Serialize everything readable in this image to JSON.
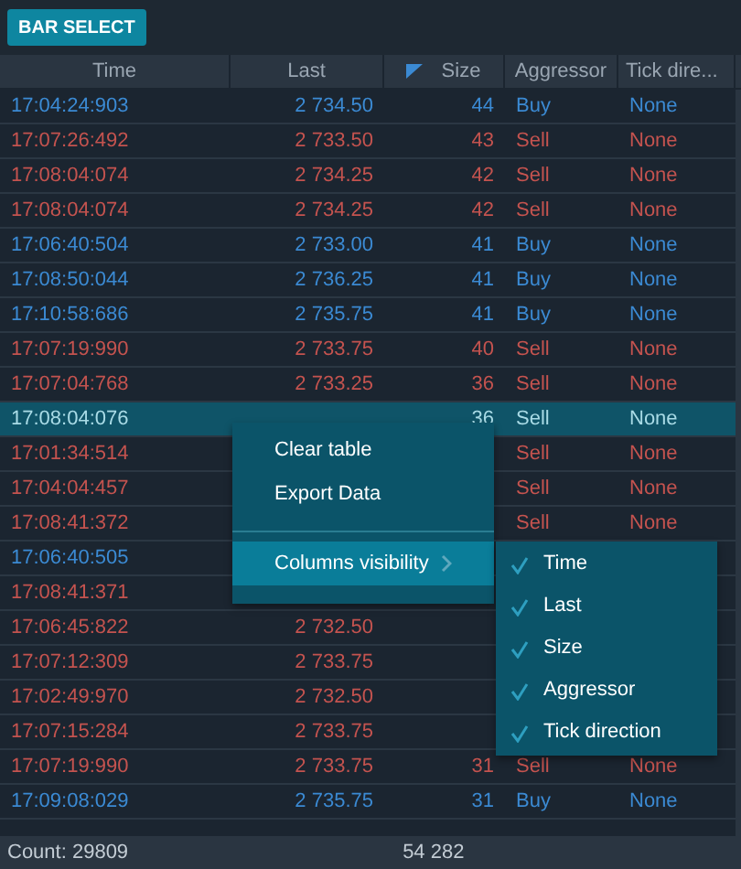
{
  "toolbar": {
    "button": "BAR SELECT"
  },
  "table": {
    "columns": [
      {
        "label": "Time",
        "sorted": false
      },
      {
        "label": "Last",
        "sorted": false
      },
      {
        "label": "Size",
        "sorted": true
      },
      {
        "label": "Aggressor",
        "sorted": false
      },
      {
        "label": "Tick dire...",
        "sorted": false
      }
    ],
    "rows": [
      {
        "time": "17:04:24:903",
        "last": "2 734.50",
        "size": "44",
        "aggressor": "Buy",
        "tick": "None",
        "color": "#3b8ad3",
        "selected": false
      },
      {
        "time": "17:07:26:492",
        "last": "2 733.50",
        "size": "43",
        "aggressor": "Sell",
        "tick": "None",
        "color": "#c4534f",
        "selected": false
      },
      {
        "time": "17:08:04:074",
        "last": "2 734.25",
        "size": "42",
        "aggressor": "Sell",
        "tick": "None",
        "color": "#c4534f",
        "selected": false
      },
      {
        "time": "17:08:04:074",
        "last": "2 734.25",
        "size": "42",
        "aggressor": "Sell",
        "tick": "None",
        "color": "#c4534f",
        "selected": false
      },
      {
        "time": "17:06:40:504",
        "last": "2 733.00",
        "size": "41",
        "aggressor": "Buy",
        "tick": "None",
        "color": "#3b8ad3",
        "selected": false
      },
      {
        "time": "17:08:50:044",
        "last": "2 736.25",
        "size": "41",
        "aggressor": "Buy",
        "tick": "None",
        "color": "#3b8ad3",
        "selected": false
      },
      {
        "time": "17:10:58:686",
        "last": "2 735.75",
        "size": "41",
        "aggressor": "Buy",
        "tick": "None",
        "color": "#3b8ad3",
        "selected": false
      },
      {
        "time": "17:07:19:990",
        "last": "2 733.75",
        "size": "40",
        "aggressor": "Sell",
        "tick": "None",
        "color": "#c4534f",
        "selected": false
      },
      {
        "time": "17:07:04:768",
        "last": "2 733.25",
        "size": "36",
        "aggressor": "Sell",
        "tick": "None",
        "color": "#c4534f",
        "selected": false
      },
      {
        "time": "17:08:04:076",
        "size": "36",
        "aggressor": "Sell",
        "tick": "None",
        "selected": true
      },
      {
        "time": "17:01:34:514",
        "aggressor": "Sell",
        "tick": "None",
        "color": "#c4534f",
        "selected": false
      },
      {
        "time": "17:04:04:457",
        "aggressor": "Sell",
        "tick": "None",
        "color": "#c4534f",
        "selected": false
      },
      {
        "time": "17:08:41:372",
        "aggressor": "Sell",
        "tick": "None",
        "color": "#c4534f",
        "selected": false
      },
      {
        "time": "17:06:40:505",
        "color": "#3b8ad3",
        "selected": false
      },
      {
        "time": "17:08:41:371",
        "color": "#c4534f",
        "selected": false
      },
      {
        "time": "17:06:45:822",
        "last": "2 732.50",
        "color": "#c4534f",
        "selected": false
      },
      {
        "time": "17:07:12:309",
        "last": "2 733.75",
        "color": "#c4534f",
        "selected": false
      },
      {
        "time": "17:02:49:970",
        "last": "2 732.50",
        "color": "#c4534f",
        "selected": false
      },
      {
        "time": "17:07:15:284",
        "last": "2 733.75",
        "color": "#c4534f",
        "selected": false
      },
      {
        "time": "17:07:19:990",
        "last": "2 733.75",
        "size": "31",
        "aggressor": "Sell",
        "tick": "None",
        "color": "#c4534f",
        "selected": false
      },
      {
        "time": "17:09:08:029",
        "last": "2 735.75",
        "size": "31",
        "aggressor": "Buy",
        "tick": "None",
        "color": "#3b8ad3",
        "selected": false
      }
    ]
  },
  "context_menu": {
    "items": [
      {
        "label": "Clear table",
        "kind": "item",
        "selected": false
      },
      {
        "label": "Export Data",
        "kind": "item",
        "selected": false
      },
      {
        "label": "Columns visibility",
        "kind": "submenu",
        "selected": true
      }
    ],
    "submenu": [
      {
        "label": "Time",
        "checked": true
      },
      {
        "label": "Last",
        "checked": true
      },
      {
        "label": "Size",
        "checked": true
      },
      {
        "label": "Aggressor",
        "checked": true
      },
      {
        "label": "Tick direction",
        "checked": true
      }
    ]
  },
  "status_bar": {
    "count": "Count:  29809",
    "total": "54 282"
  }
}
